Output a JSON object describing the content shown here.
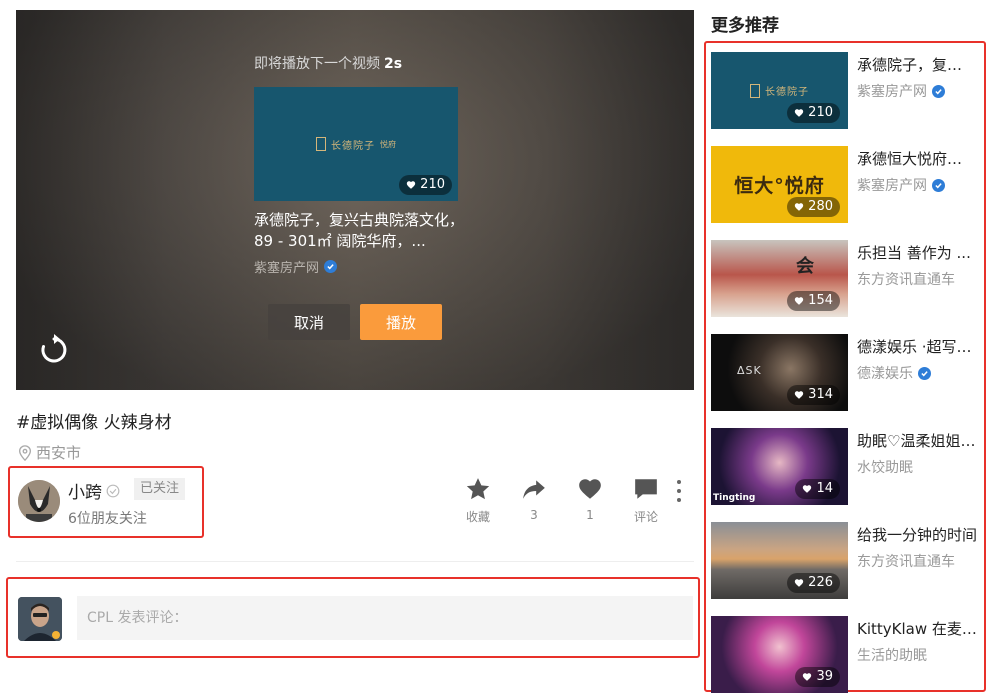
{
  "player": {
    "next_hint": "即将播放下一个视频",
    "countdown": "2s",
    "next_video": {
      "logo_text": "长德院子",
      "logo_sub": "悦府",
      "likes": "210",
      "title": "承德院子，复兴古典院落文化，89 - 301㎡ 阔院华府，...",
      "author": "紫塞房产网"
    },
    "cancel_label": "取消",
    "play_label": "播放"
  },
  "video": {
    "title": "#虚拟偶像 火辣身材",
    "location": "西安市"
  },
  "author": {
    "name": "小跨",
    "follow_status": "已关注",
    "friends": "6位朋友关注"
  },
  "actions": [
    {
      "label": "收藏",
      "icon": "star-icon"
    },
    {
      "label": "3",
      "icon": "share-icon"
    },
    {
      "label": "1",
      "icon": "heart-icon"
    },
    {
      "label": "评论",
      "icon": "comment-icon"
    }
  ],
  "comment": {
    "placeholder": "CPL 发表评论："
  },
  "recommend": {
    "heading": "更多推荐",
    "items": [
      {
        "title": "承德院子，复兴古典院落文化",
        "author": "紫塞房产网",
        "verified": true,
        "likes": "210",
        "thumb_text": "长德院子"
      },
      {
        "title": "承德恒大悦府，品质生活",
        "author": "紫塞房产网",
        "verified": true,
        "likes": "280",
        "thumb_text": "恒大°悦府"
      },
      {
        "title": "乐担当 善作为 ...",
        "author": "东方资讯直通车",
        "verified": false,
        "likes": "154",
        "thumb_text": "会"
      },
      {
        "title": "德漾娱乐 ·超写实虚拟人",
        "author": "德漾娱乐",
        "verified": true,
        "likes": "314",
        "thumb_text": "ΔSK"
      },
      {
        "title": "助眠♡温柔姐姐哄睡",
        "author": "水饺助眠",
        "verified": false,
        "likes": "14",
        "thumb_text": "Tingting"
      },
      {
        "title": "给我一分钟的时间",
        "author": "东方资讯直通车",
        "verified": false,
        "likes": "226",
        "thumb_text": ""
      },
      {
        "title": "KittyKlaw 在麦克风前",
        "author": "生活的助眠",
        "verified": false,
        "likes": "39",
        "thumb_text": ""
      }
    ]
  },
  "colors": {
    "highlight_border": "#e8312a",
    "play_button": "#fa9b3c",
    "verify_badge": "#2e7dd7"
  }
}
